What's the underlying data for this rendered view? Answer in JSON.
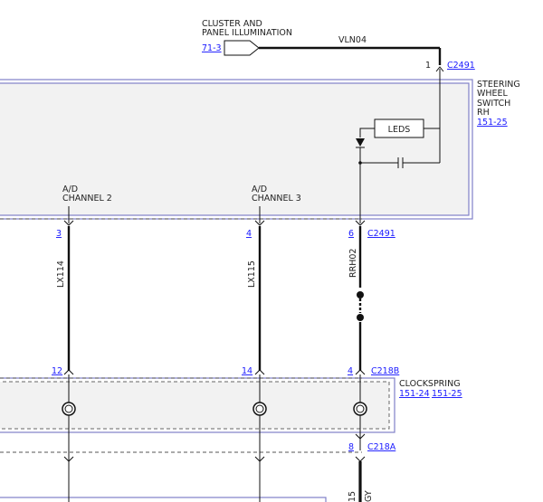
{
  "cluster": {
    "label_line1": "CLUSTER AND",
    "label_line2": "PANEL ILLUMINATION",
    "ref": "71-3",
    "wire": "VLN04"
  },
  "steering_switch": {
    "line1": "STEERING",
    "line2": "WHEEL",
    "line3": "SWITCH",
    "line4": "RH",
    "ref": "151-25",
    "leds_label": "LEDS",
    "top_pin": "1",
    "top_connector": "C2491",
    "channel2_line1": "A/D",
    "channel2_line2": "CHANNEL 2",
    "channel3_line1": "A/D",
    "channel3_line2": "CHANNEL 3"
  },
  "pins_c2491": [
    {
      "pin": "3"
    },
    {
      "pin": "4"
    },
    {
      "pin": "6",
      "connector": "C2491"
    }
  ],
  "wires": [
    {
      "name": "LX114"
    },
    {
      "name": "LX115"
    },
    {
      "name": "RRH02"
    }
  ],
  "pins_c218b": [
    {
      "pin": "12"
    },
    {
      "pin": "14"
    },
    {
      "pin": "4",
      "connector": "C218B"
    }
  ],
  "clockspring": {
    "label": "CLOCKSPRING",
    "ref1": "151-24",
    "ref2": "151-25"
  },
  "bottom": {
    "pin": "8",
    "connector": "C218A",
    "wire_partial": "15",
    "wire_color_partial": "GY"
  }
}
